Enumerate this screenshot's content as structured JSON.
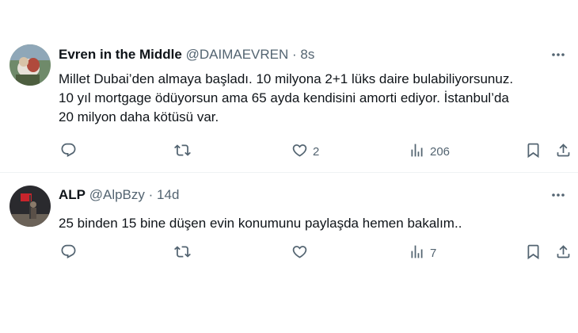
{
  "tweets": [
    {
      "name": "Evren in the Middle",
      "handle": "@DAIMAEVREN",
      "separator": "·",
      "time": "8s",
      "text": "Millet Dubai’den almaya başladı. 10 milyona 2+1 lüks daire bulabiliyorsunuz.\n10 yıl mortgage ödüyorsun ama 65 ayda kendisini amorti ediyor. İstanbul’da\n20 milyon daha kötüsü var.",
      "likes": "2",
      "views": "206"
    },
    {
      "name": "ALP",
      "handle": "@AlpBzy",
      "separator": "·",
      "time": "14d",
      "text": "25 binden 15 bine düşen evin konumunu paylaşda hemen bakalım..",
      "likes": "",
      "views": "7"
    }
  ],
  "icons": {
    "reply": "reply-icon",
    "retweet": "retweet-icon",
    "like": "heart-icon",
    "views": "views-icon",
    "bookmark": "bookmark-icon",
    "share": "share-icon",
    "more": "more-icon"
  },
  "colors": {
    "text": "#0f1419",
    "secondary": "#536471",
    "divider": "#eff3f4"
  }
}
